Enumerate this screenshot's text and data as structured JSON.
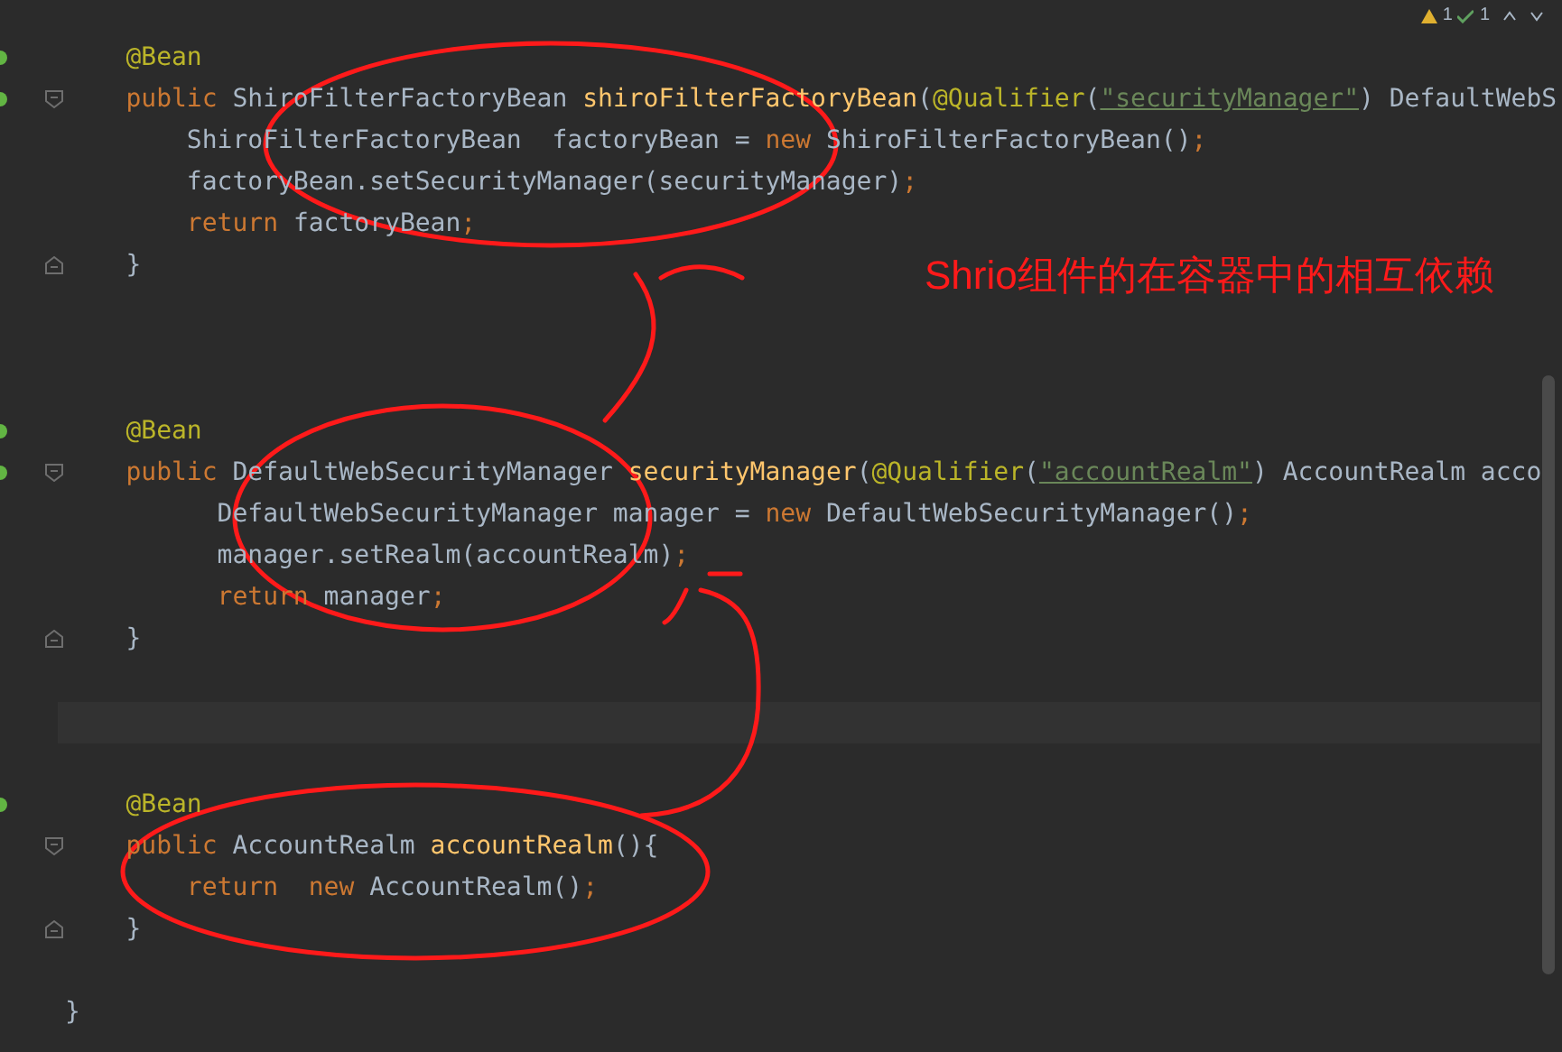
{
  "inspections": {
    "warnings": "1",
    "weak_warnings": "1"
  },
  "editor": {
    "sections": [
      {
        "kind": "code",
        "lines": [
          {
            "bean": true,
            "fold_start": false,
            "fold_end": false,
            "tokens": [
              {
                "kind": "annotation",
                "text": "    @Bean"
              }
            ]
          },
          {
            "bean": true,
            "fold_start": true,
            "fold_end": false,
            "tokens": [
              {
                "kind": "keyword",
                "text": "    public "
              },
              {
                "kind": "plain",
                "text": "ShiroFilterFactoryBean "
              },
              {
                "kind": "method",
                "text": "shiroFilterFactoryBean"
              },
              {
                "kind": "plain",
                "text": "("
              },
              {
                "kind": "annotation",
                "text": "@Qualifier"
              },
              {
                "kind": "plain",
                "text": "("
              },
              {
                "kind": "ref_string",
                "text": "\"securityManager\""
              },
              {
                "kind": "plain",
                "text": ") DefaultWebS"
              }
            ]
          },
          {
            "bean": false,
            "fold_start": false,
            "fold_end": false,
            "tokens": [
              {
                "kind": "plain",
                "text": "        ShiroFilterFactoryBean  factoryBean = "
              },
              {
                "kind": "keyword",
                "text": "new "
              },
              {
                "kind": "plain",
                "text": "ShiroFilterFactoryBean()"
              },
              {
                "kind": "keyword",
                "text": ";"
              }
            ]
          },
          {
            "bean": false,
            "fold_start": false,
            "fold_end": false,
            "tokens": [
              {
                "kind": "plain",
                "text": "        factoryBean.setSecurityManager(securityManager)"
              },
              {
                "kind": "keyword",
                "text": ";"
              }
            ]
          },
          {
            "bean": false,
            "fold_start": false,
            "fold_end": false,
            "tokens": [
              {
                "kind": "keyword",
                "text": "        return "
              },
              {
                "kind": "plain",
                "text": "factoryBean"
              },
              {
                "kind": "keyword",
                "text": ";"
              }
            ]
          },
          {
            "bean": false,
            "fold_start": false,
            "fold_end": true,
            "tokens": [
              {
                "kind": "plain",
                "text": "    }"
              }
            ]
          }
        ]
      },
      {
        "kind": "code",
        "lines": [
          {
            "bean": true,
            "fold_start": false,
            "fold_end": false,
            "tokens": [
              {
                "kind": "annotation",
                "text": "    @Bean"
              }
            ]
          },
          {
            "bean": true,
            "fold_start": true,
            "fold_end": false,
            "tokens": [
              {
                "kind": "keyword",
                "text": "    public "
              },
              {
                "kind": "plain",
                "text": "DefaultWebSecurityManager "
              },
              {
                "kind": "method",
                "text": "securityManager"
              },
              {
                "kind": "plain",
                "text": "("
              },
              {
                "kind": "annotation",
                "text": "@Qualifier"
              },
              {
                "kind": "plain",
                "text": "("
              },
              {
                "kind": "ref_string",
                "text": "\"accountRealm\""
              },
              {
                "kind": "plain",
                "text": ") AccountRealm acco"
              }
            ]
          },
          {
            "bean": false,
            "fold_start": false,
            "fold_end": false,
            "tokens": [
              {
                "kind": "plain",
                "text": "          DefaultWebSecurityManager manager = "
              },
              {
                "kind": "keyword",
                "text": "new "
              },
              {
                "kind": "plain",
                "text": "DefaultWebSecurityManager()"
              },
              {
                "kind": "keyword",
                "text": ";"
              }
            ]
          },
          {
            "bean": false,
            "fold_start": false,
            "fold_end": false,
            "tokens": [
              {
                "kind": "plain",
                "text": "          manager.setRealm(accountRealm)"
              },
              {
                "kind": "keyword",
                "text": ";"
              }
            ]
          },
          {
            "bean": false,
            "fold_start": false,
            "fold_end": false,
            "tokens": [
              {
                "kind": "keyword",
                "text": "          return "
              },
              {
                "kind": "plain",
                "text": "manager"
              },
              {
                "kind": "keyword",
                "text": ";"
              }
            ]
          },
          {
            "bean": false,
            "fold_start": false,
            "fold_end": true,
            "tokens": [
              {
                "kind": "plain",
                "text": "    }"
              }
            ]
          }
        ]
      },
      {
        "kind": "caret_line"
      },
      {
        "kind": "code",
        "lines": [
          {
            "bean": true,
            "fold_start": false,
            "fold_end": false,
            "tokens": [
              {
                "kind": "annotation",
                "text": "    @Bean"
              }
            ]
          },
          {
            "bean": false,
            "fold_start": true,
            "fold_end": false,
            "tokens": [
              {
                "kind": "keyword",
                "text": "    public "
              },
              {
                "kind": "plain",
                "text": "AccountRealm "
              },
              {
                "kind": "method",
                "text": "accountRealm"
              },
              {
                "kind": "plain",
                "text": "(){"
              }
            ]
          },
          {
            "bean": false,
            "fold_start": false,
            "fold_end": false,
            "tokens": [
              {
                "kind": "keyword",
                "text": "        return  new "
              },
              {
                "kind": "plain",
                "text": "AccountRealm()"
              },
              {
                "kind": "keyword",
                "text": ";"
              }
            ]
          },
          {
            "bean": false,
            "fold_start": false,
            "fold_end": true,
            "tokens": [
              {
                "kind": "plain",
                "text": "    }"
              }
            ]
          }
        ]
      },
      {
        "kind": "code",
        "lines": [
          {
            "bean": false,
            "fold_start": false,
            "fold_end": false,
            "tokens": [
              {
                "kind": "plain",
                "text": "}"
              }
            ]
          }
        ]
      }
    ]
  },
  "annotation": {
    "note": "Shrio组件的在容器中的相互依赖"
  }
}
